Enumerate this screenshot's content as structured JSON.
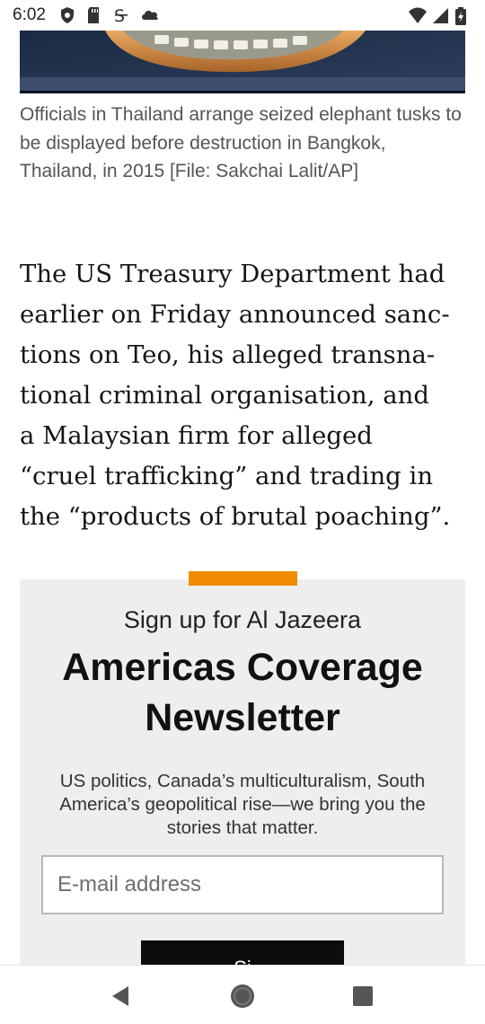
{
  "status_bar": {
    "time": "6:02",
    "left_icons": [
      "shield-icon",
      "sd-card-icon",
      "sync-icon",
      "cloud-icon"
    ],
    "right_icons": [
      "wifi-icon",
      "cell-signal-icon",
      "battery-icon"
    ]
  },
  "article": {
    "image_alt": "Seized elephant tusks arranged for display",
    "caption": "Officials in Thailand arrange seized elephant tusks to be displayed before destruction in Bangkok, Thailand, in 2015 [File: Sakchai Lalit/AP]",
    "paragraph_lines": [
      "The US Treasury Department had",
      "earlier on Friday announced sanc-",
      "tions on Teo, his alleged transna-",
      "tional criminal organisation, and",
      "a Malaysian firm for alleged",
      "“cruel trafficking” and trading in",
      "the “products of brutal poaching”."
    ]
  },
  "newsletter": {
    "accent_color": "#f28a00",
    "kicker": "Sign up for Al Jazeera",
    "title_line1": "Americas Coverage",
    "title_line2": "Newsletter",
    "description_lines": [
      "US politics, Canada’s multiculturalism, South",
      "America’s geopolitical rise—we bring you the",
      "stories that matter."
    ],
    "email_placeholder": "E-mail address",
    "submit_label": "Si"
  },
  "nav_bar": {
    "buttons": [
      "back-icon",
      "home-icon",
      "recents-icon"
    ]
  }
}
